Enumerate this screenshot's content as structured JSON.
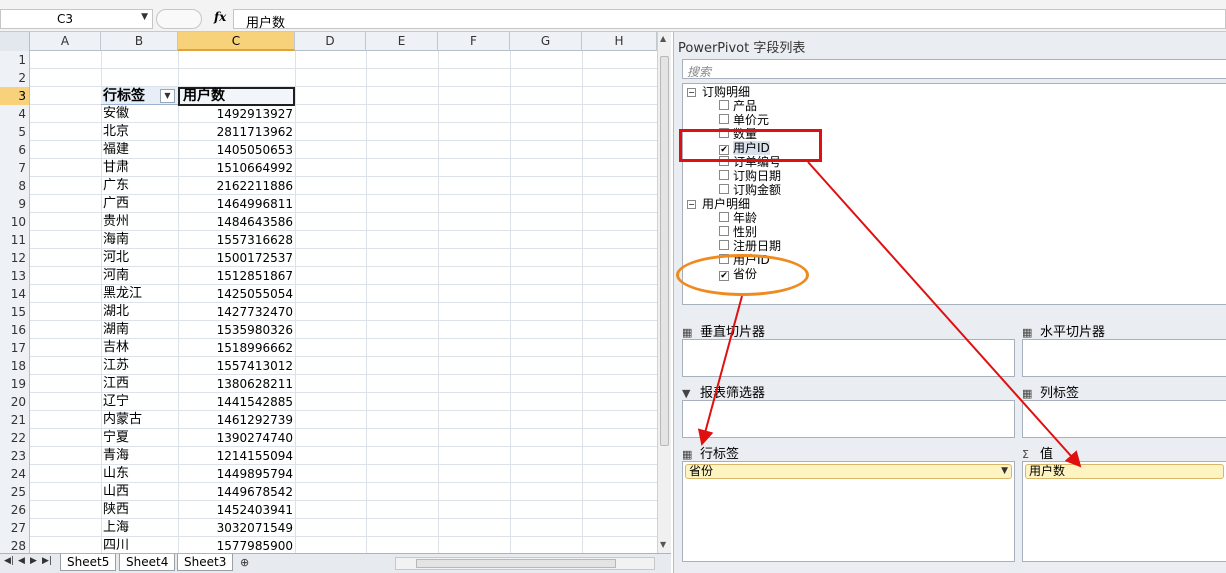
{
  "formula_bar": {
    "name_box": "C3",
    "fx": "fx",
    "formula": "用户数"
  },
  "columns": [
    "A",
    "B",
    "C",
    "D",
    "E",
    "F",
    "G",
    "H"
  ],
  "selected_column": "C",
  "pivot": {
    "row_label_header": "行标签",
    "value_header": "用户数",
    "rows": [
      {
        "row": 4,
        "label": "安徽",
        "value": "1492913927"
      },
      {
        "row": 5,
        "label": "北京",
        "value": "2811713962"
      },
      {
        "row": 6,
        "label": "福建",
        "value": "1405050653"
      },
      {
        "row": 7,
        "label": "甘肃",
        "value": "1510664992"
      },
      {
        "row": 8,
        "label": "广东",
        "value": "2162211886"
      },
      {
        "row": 9,
        "label": "广西",
        "value": "1464996811"
      },
      {
        "row": 10,
        "label": "贵州",
        "value": "1484643586"
      },
      {
        "row": 11,
        "label": "海南",
        "value": "1557316628"
      },
      {
        "row": 12,
        "label": "河北",
        "value": "1500172537"
      },
      {
        "row": 13,
        "label": "河南",
        "value": "1512851867"
      },
      {
        "row": 14,
        "label": "黑龙江",
        "value": "1425055054"
      },
      {
        "row": 15,
        "label": "湖北",
        "value": "1427732470"
      },
      {
        "row": 16,
        "label": "湖南",
        "value": "1535980326"
      },
      {
        "row": 17,
        "label": "吉林",
        "value": "1518996662"
      },
      {
        "row": 18,
        "label": "江苏",
        "value": "1557413012"
      },
      {
        "row": 19,
        "label": "江西",
        "value": "1380628211"
      },
      {
        "row": 20,
        "label": "辽宁",
        "value": "1441542885"
      },
      {
        "row": 21,
        "label": "内蒙古",
        "value": "1461292739"
      },
      {
        "row": 22,
        "label": "宁夏",
        "value": "1390274740"
      },
      {
        "row": 23,
        "label": "青海",
        "value": "1214155094"
      },
      {
        "row": 24,
        "label": "山东",
        "value": "1449895794"
      },
      {
        "row": 25,
        "label": "山西",
        "value": "1449678542"
      },
      {
        "row": 26,
        "label": "陕西",
        "value": "1452403941"
      },
      {
        "row": 27,
        "label": "上海",
        "value": "3032071549"
      },
      {
        "row": 28,
        "label": "四川",
        "value": "1577985900"
      }
    ]
  },
  "sheet_tabs": [
    "Sheet5",
    "Sheet4",
    "Sheet3"
  ],
  "powerpivot": {
    "title": "PowerPivot 字段列表",
    "search_placeholder": "搜索",
    "tables": [
      {
        "name": "订购明细",
        "fields": [
          {
            "name": "产品",
            "checked": false
          },
          {
            "name": "单价元",
            "checked": false
          },
          {
            "name": "数量",
            "checked": false
          },
          {
            "name": "用户ID",
            "checked": true
          },
          {
            "name": "订单编号",
            "checked": false
          },
          {
            "name": "订购日期",
            "checked": false
          },
          {
            "name": "订购金额",
            "checked": false
          }
        ]
      },
      {
        "name": "用户明细",
        "fields": [
          {
            "name": "年龄",
            "checked": false
          },
          {
            "name": "性别",
            "checked": false
          },
          {
            "name": "注册日期",
            "checked": false
          },
          {
            "name": "用户ID",
            "checked": false
          },
          {
            "name": "省份",
            "checked": true
          }
        ]
      }
    ],
    "zones": {
      "vertical_slicer": "垂直切片器",
      "horizontal_slicer": "水平切片器",
      "report_filter": "报表筛选器",
      "column_labels": "列标签",
      "row_labels": "行标签",
      "values": "值",
      "row_labels_item": "省份",
      "values_item": "用户数"
    }
  },
  "colors": {
    "annotation_red": "#e01010",
    "annotation_orange": "#ef8a1f",
    "selected_header": "#f8d27a"
  }
}
